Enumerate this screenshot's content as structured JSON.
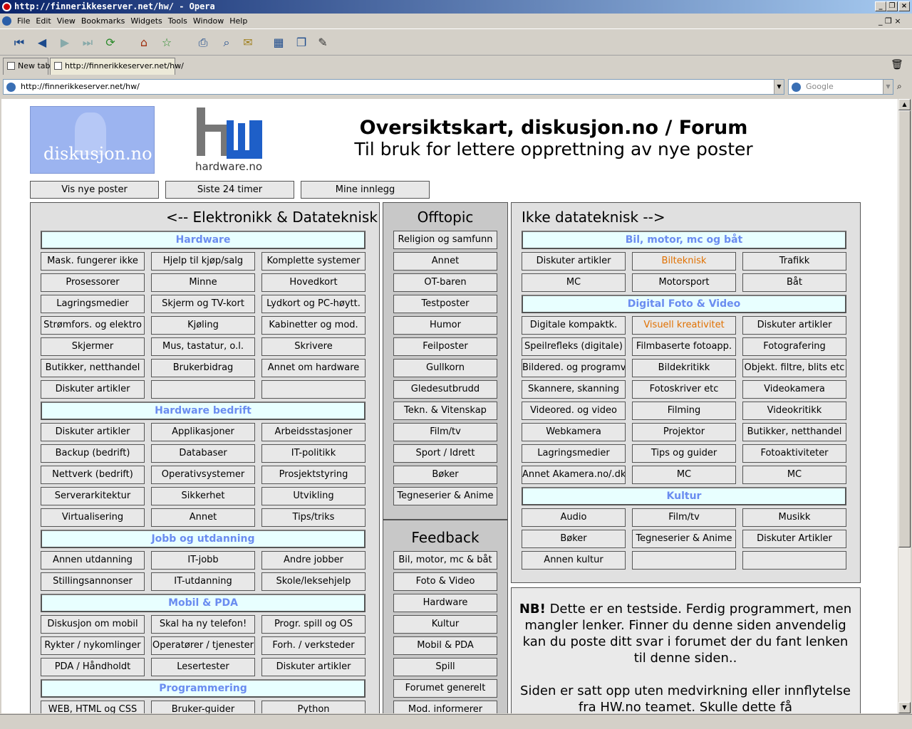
{
  "window": {
    "title": "http://finnerikkeserver.net/hw/ - Opera"
  },
  "menu": [
    "File",
    "Edit",
    "View",
    "Bookmarks",
    "Widgets",
    "Tools",
    "Window",
    "Help"
  ],
  "tabs": {
    "new_tab": "New tab",
    "active_tab": "http://finnerikkeserver.net/hw/"
  },
  "address": {
    "url": "http://finnerikkeserver.net/hw/",
    "search_placeholder": "Google"
  },
  "logos": {
    "diskusjon": "diskusjon.no",
    "hardware": "hardware.no"
  },
  "header": {
    "title": "Oversiktskart, diskusjon.no / Forum",
    "subtitle": "Til bruk for lettere opprettning av nye poster"
  },
  "top_buttons": [
    "Vis nye poster",
    "Siste 24 timer",
    "Mine innlegg"
  ],
  "left": {
    "title": "<-- Elektronikk & Datateknisk",
    "hardware": {
      "label": "Hardware",
      "items": [
        "Mask. fungerer ikke",
        "Hjelp til kjøp/salg",
        "Komplette systemer",
        "Prosessorer",
        "Minne",
        "Hovedkort",
        "Lagringsmedier",
        "Skjerm og TV-kort",
        "Lydkort og PC-høytt.",
        "Strømfors. og elektro",
        "Kjøling",
        "Kabinetter og mod.",
        "Skjermer",
        "Mus, tastatur, o.l.",
        "Skrivere",
        "Butikker, netthandel",
        "Brukerbidrag",
        "Annet om hardware",
        "Diskuter artikler",
        "",
        ""
      ]
    },
    "bedrift": {
      "label": "Hardware bedrift",
      "items": [
        "Diskuter artikler",
        "Applikasjoner",
        "Arbeidsstasjoner",
        "Backup (bedrift)",
        "Databaser",
        "IT-politikk",
        "Nettverk (bedrift)",
        "Operativsystemer",
        "Prosjektstyring",
        "Serverarkitektur",
        "Sikkerhet",
        "Utvikling",
        "Virtualisering",
        "Annet",
        "Tips/triks"
      ]
    },
    "jobb": {
      "label": "Jobb og utdanning",
      "items": [
        "Annen utdanning",
        "IT-jobb",
        "Andre jobber",
        "Stillingsannonser",
        "IT-utdanning",
        "Skole/leksehjelp"
      ]
    },
    "mobil": {
      "label": "Mobil & PDA",
      "items": [
        "Diskusjon om mobil",
        "Skal ha ny telefon!",
        "Progr. spill og OS",
        "Rykter / nykomlinger",
        "Operatører / tjenester",
        "Forh. / verksteder",
        "PDA / Håndholdt",
        "Lesertester",
        "Diskuter artikler"
      ]
    },
    "prog": {
      "label": "Programmering",
      "items": [
        "WEB, HTML og CSS",
        "Bruker-guider",
        "Python"
      ]
    }
  },
  "mid": {
    "title": "Offtopic",
    "items": [
      "Religion og samfunn",
      "Annet",
      "OT-baren",
      "Testposter",
      "Humor",
      "Feilposter",
      "Gullkorn",
      "Gledesutbrudd",
      "Tekn. & Vitenskap",
      "Film/tv",
      "Sport / Idrett",
      "Bøker",
      "Tegneserier & Anime"
    ],
    "feedback_title": "Feedback",
    "feedback": [
      "Bil, motor, mc & båt",
      "Foto & Video",
      "Hardware",
      "Kultur",
      "Mobil & PDA",
      "Spill",
      "Forumet generelt",
      "Mod. informerer"
    ]
  },
  "right": {
    "title": "Ikke datateknisk -->",
    "bil": {
      "label": "Bil, motor, mc og båt",
      "items": [
        "Diskuter artikler",
        "Bilteknisk",
        "Trafikk",
        "MC",
        "Motorsport",
        "Båt"
      ]
    },
    "foto": {
      "label": "Digital Foto & Video",
      "items": [
        "Digitale kompaktk.",
        "Visuell kreativitet",
        "Diskuter artikler",
        "Speilrefleks (digitale)",
        "Filmbaserte fotoapp.",
        "Fotografering",
        "Bildered. og programv.",
        "Bildekritikk",
        "Objekt. filtre, blits etc",
        "Skannere, skanning",
        "Fotoskriver etc",
        "Videokamera",
        "Videored. og video",
        "Filming",
        "Videokritikk",
        "Webkamera",
        "Projektor",
        "Butikker, netthandel",
        "Lagringsmedier",
        "Tips og guider",
        "Fotoaktiviteter",
        "Annet Akamera.no/.dk",
        "MC",
        "MC"
      ]
    },
    "kultur": {
      "label": "Kultur",
      "items": [
        "Audio",
        "Film/tv",
        "Musikk",
        "Bøker",
        "Tegneserier & Anime",
        "Diskuter Artikler",
        "Annen kultur",
        "",
        ""
      ]
    }
  },
  "note": {
    "bold": "NB!",
    "p1": "Dette er en testside. Ferdig programmert, men mangler lenker. Finner du denne siden anvendelig kan du poste ditt svar i forumet der du fant lenken til denne siden..",
    "p2": "Siden er satt opp uten medvirkning eller innflytelse fra HW.no teamet. Skulle dette få"
  }
}
